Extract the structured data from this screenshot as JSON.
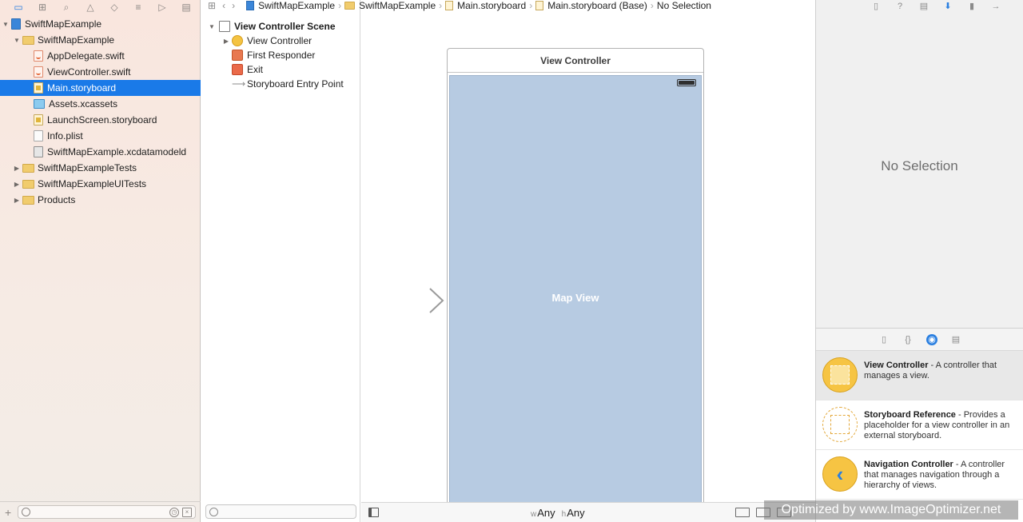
{
  "navigator": {
    "toolbar_icons": [
      "folder-icon",
      "hierarchy-icon",
      "search-icon",
      "warning-icon",
      "test-icon",
      "debug-icon",
      "breakpoint-icon",
      "report-icon"
    ],
    "tree": [
      {
        "label": "SwiftMapExample",
        "kind": "project",
        "level": 0,
        "disclosure": "▼"
      },
      {
        "label": "SwiftMapExample",
        "kind": "folder",
        "level": 1,
        "disclosure": "▼"
      },
      {
        "label": "AppDelegate.swift",
        "kind": "swift",
        "level": 2,
        "disclosure": ""
      },
      {
        "label": "ViewController.swift",
        "kind": "swift",
        "level": 2,
        "disclosure": ""
      },
      {
        "label": "Main.storyboard",
        "kind": "sb",
        "level": 2,
        "disclosure": "",
        "selected": true
      },
      {
        "label": "Assets.xcassets",
        "kind": "assets",
        "level": 2,
        "disclosure": ""
      },
      {
        "label": "LaunchScreen.storyboard",
        "kind": "sb",
        "level": 2,
        "disclosure": ""
      },
      {
        "label": "Info.plist",
        "kind": "plist",
        "level": 2,
        "disclosure": ""
      },
      {
        "label": "SwiftMapExample.xcdatamodeld",
        "kind": "model",
        "level": 2,
        "disclosure": ""
      },
      {
        "label": "SwiftMapExampleTests",
        "kind": "folder",
        "level": 1,
        "disclosure": "▶"
      },
      {
        "label": "SwiftMapExampleUITests",
        "kind": "folder",
        "level": 1,
        "disclosure": "▶"
      },
      {
        "label": "Products",
        "kind": "folder",
        "level": 1,
        "disclosure": "▶"
      }
    ]
  },
  "jumpbar": {
    "segments": [
      "SwiftMapExample",
      "SwiftMapExample",
      "Main.storyboard",
      "Main.storyboard (Base)",
      "No Selection"
    ]
  },
  "outline": {
    "scene_title": "View Controller Scene",
    "items": [
      {
        "label": "View Controller",
        "kind": "vc",
        "disclosure": "▶"
      },
      {
        "label": "First Responder",
        "kind": "fr",
        "disclosure": ""
      },
      {
        "label": "Exit",
        "kind": "exit",
        "disclosure": ""
      },
      {
        "label": "Storyboard Entry Point",
        "kind": "entry",
        "disclosure": ""
      }
    ]
  },
  "canvas": {
    "scene_title": "View Controller",
    "map_label": "Map View"
  },
  "bottom_bar": {
    "w_prefix": "w",
    "w_value": "Any",
    "h_prefix": "h",
    "h_value": "Any"
  },
  "inspector": {
    "no_selection": "No Selection",
    "library": [
      {
        "title": "View Controller",
        "desc": " - A controller that manages a view.",
        "thumb": "vc",
        "selected": true
      },
      {
        "title": "Storyboard Reference",
        "desc": " - Provides a placeholder for a view controller in an external storyboard.",
        "thumb": "sbref",
        "selected": false
      },
      {
        "title": "Navigation Controller",
        "desc": " - A controller that manages navigation through a hierarchy of views.",
        "thumb": "nav",
        "selected": false
      }
    ]
  },
  "watermark": "Optimized by www.ImageOptimizer.net",
  "colors": {
    "selection": "#1a7ae8",
    "map_view": "#b7cbe2",
    "accent": "#2a7fe0"
  }
}
